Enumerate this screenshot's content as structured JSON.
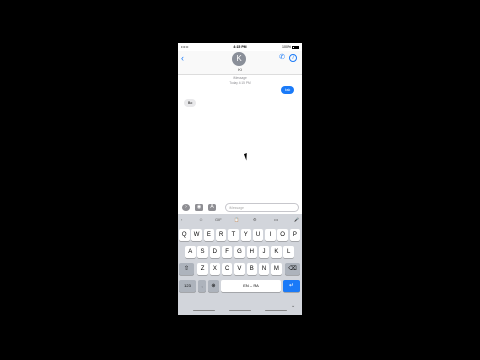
{
  "status": {
    "signal": "••••• ",
    "time": "4:15 PM",
    "battery": "100%"
  },
  "nav": {
    "back": "‹",
    "avatar_initial": "K",
    "contact_name": "Ki"
  },
  "thread": {
    "meta_line1": "iMessage",
    "meta_line2": "Today 4:15 PM",
    "outgoing": [
      "ksk"
    ],
    "incoming": [
      "Bo"
    ]
  },
  "compose": {
    "placeholder": "iMessage"
  },
  "keyboard": {
    "toolbar": [
      "‹",
      "☺",
      "GIF",
      "📋",
      "⚙",
      "•••",
      "🎤"
    ],
    "row1": [
      "Q",
      "W",
      "E",
      "R",
      "T",
      "Y",
      "U",
      "I",
      "O",
      "P"
    ],
    "row2": [
      "A",
      "S",
      "D",
      "F",
      "G",
      "H",
      "J",
      "K",
      "L"
    ],
    "row3": [
      "Z",
      "X",
      "C",
      "V",
      "B",
      "N",
      "M"
    ],
    "numbers_label": "123",
    "space_label": "EN – ЯA",
    "return_label": "↵",
    "shift_label": "⇧",
    "delete_label": "⌫",
    "globe_label": "⊕"
  },
  "colors": {
    "accent": "#1a7af8",
    "bubble_in": "#e9e9eb"
  }
}
